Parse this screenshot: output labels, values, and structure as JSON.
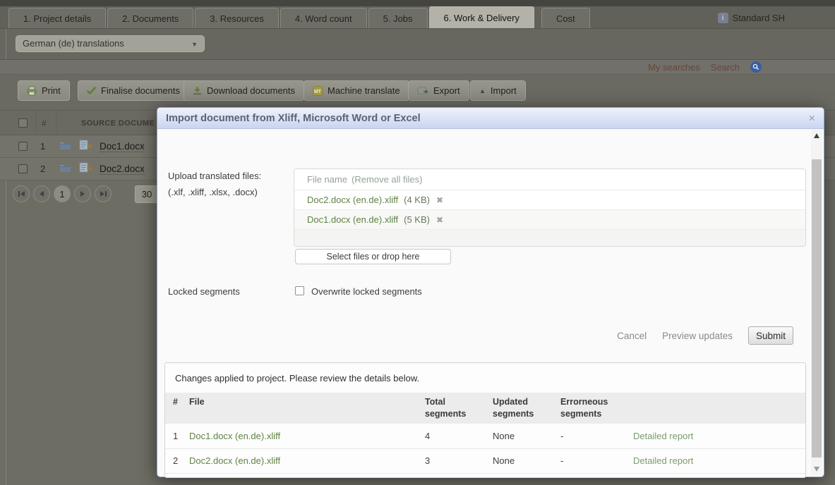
{
  "colors": {
    "accent_green": "#5e8343",
    "modal_header_blue": "#d7e0f4",
    "modal_title_text": "#5a6375",
    "link_maroon": "#69463a",
    "search_icon_blue": "#3c5d9f"
  },
  "icons": {
    "info": "i",
    "dropdown_arrow": "▼",
    "import_arrow": "▲",
    "star": "★",
    "close": "×",
    "remove_file": "✖"
  },
  "page": {
    "tabs": [
      {
        "label": "1. Project details"
      },
      {
        "label": "2. Documents"
      },
      {
        "label": "3. Resources"
      },
      {
        "label": "4. Word count"
      },
      {
        "label": "5. Jobs"
      },
      {
        "label": "6. Work & Delivery"
      },
      {
        "label": "Cost"
      }
    ],
    "active_tab": "6. Work & Delivery",
    "user_label": "Standard SH",
    "language_dropdown": {
      "value": "German (de) translations"
    },
    "search_links": {
      "my_searches": "My searches",
      "search": "Search"
    },
    "toolbar": {
      "print": "Print",
      "finalise": "Finalise documents",
      "download": "Download documents",
      "machine_translate": "Machine translate",
      "export": "Export",
      "import": "Import"
    },
    "documents_table": {
      "col_hash": "#",
      "col_source": "SOURCE DOCUME",
      "rows": [
        {
          "num": "1",
          "name": "Doc1.docx"
        },
        {
          "num": "2",
          "name": "Doc2.docx"
        }
      ]
    },
    "pagination": {
      "current_page": "1",
      "page_size": "30"
    }
  },
  "modal": {
    "title": "Import document from Xliff, Microsoft Word or Excel",
    "upload": {
      "label_line1": "Upload translated files:",
      "label_line2": "(.xlf, .xliff, .xlsx, .docx)",
      "list_header": "File name",
      "remove_all": "(Remove all files)",
      "files": [
        {
          "name": "Doc2.docx (en.de).xliff",
          "size": "(4 KB)"
        },
        {
          "name": "Doc1.docx (en.de).xliff",
          "size": "(5 KB)"
        }
      ],
      "select_button": "Select files or drop here"
    },
    "locked_segments": {
      "label": "Locked segments",
      "checkbox_label": "Overwrite locked segments",
      "checked": false
    },
    "actions": {
      "cancel": "Cancel",
      "preview": "Preview updates",
      "submit": "Submit"
    },
    "changes": {
      "message": "Changes applied to project. Please review the details below.",
      "columns": {
        "num": "#",
        "file": "File",
        "total": "Total segments",
        "updated": "Updated segments",
        "erroneous": "Errorneous segments"
      },
      "rows": [
        {
          "num": "1",
          "file": "Doc1.docx (en.de).xliff",
          "total": "4",
          "updated": "None",
          "erroneous": "-",
          "report": "Detailed report"
        },
        {
          "num": "2",
          "file": "Doc2.docx (en.de).xliff",
          "total": "3",
          "updated": "None",
          "erroneous": "-",
          "report": "Detailed report"
        }
      ]
    }
  }
}
